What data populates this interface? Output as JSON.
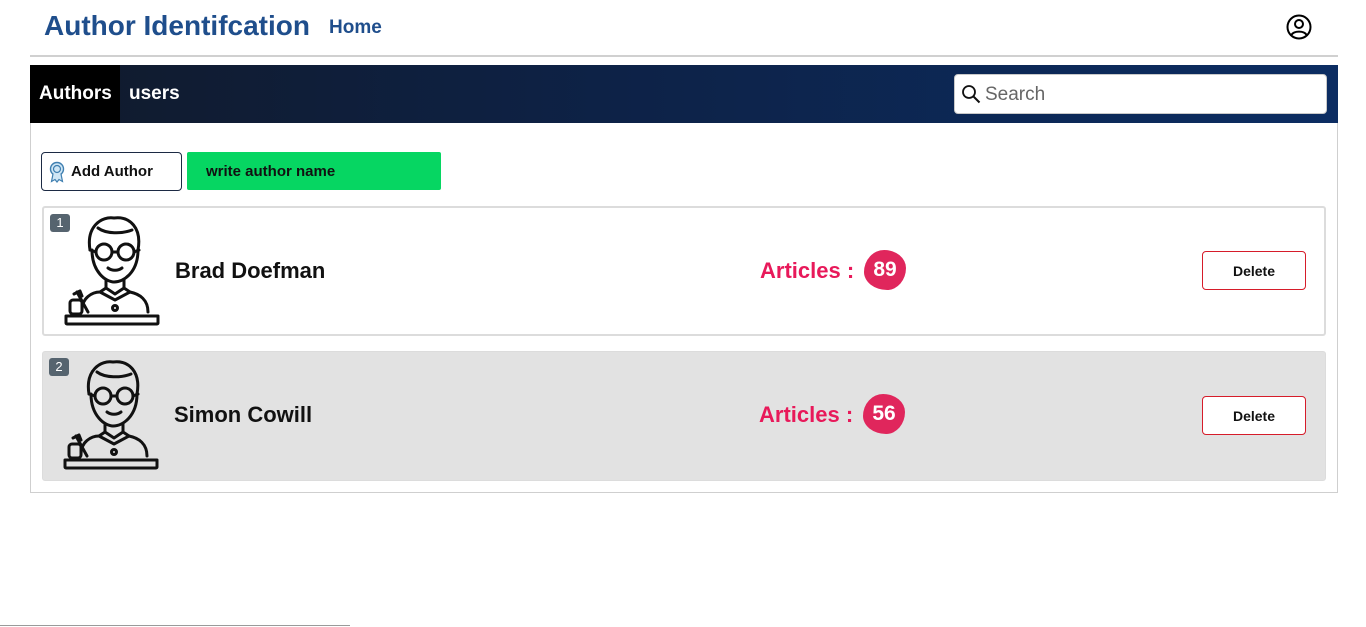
{
  "header": {
    "title": "Author Identifcation",
    "home_label": "Home",
    "user_icon": "user-circle-icon"
  },
  "nav": {
    "tabs": [
      {
        "label": "Authors",
        "active": true
      },
      {
        "label": "users",
        "active": false
      }
    ],
    "search": {
      "placeholder": "Search",
      "value": "",
      "icon": "search-icon"
    }
  },
  "toolbar": {
    "add_author_label": "Add Author",
    "add_author_icon": "award-icon",
    "name_input_placeholder": "write author name"
  },
  "authors": [
    {
      "rank": "1",
      "name": "Brad Doefman",
      "articles_label": "Articles :",
      "articles_count": "89",
      "delete_label": "Delete"
    },
    {
      "rank": "2",
      "name": "Simon Cowill",
      "articles_label": "Articles :",
      "articles_count": "56",
      "delete_label": "Delete"
    }
  ],
  "colors": {
    "brand": "#1f4e8c",
    "nav_dark": "#0d2247",
    "accent_green": "#06d662",
    "articles_pink": "#e8195a",
    "delete_red": "#d61c2a",
    "badge_gray": "#56646f"
  }
}
